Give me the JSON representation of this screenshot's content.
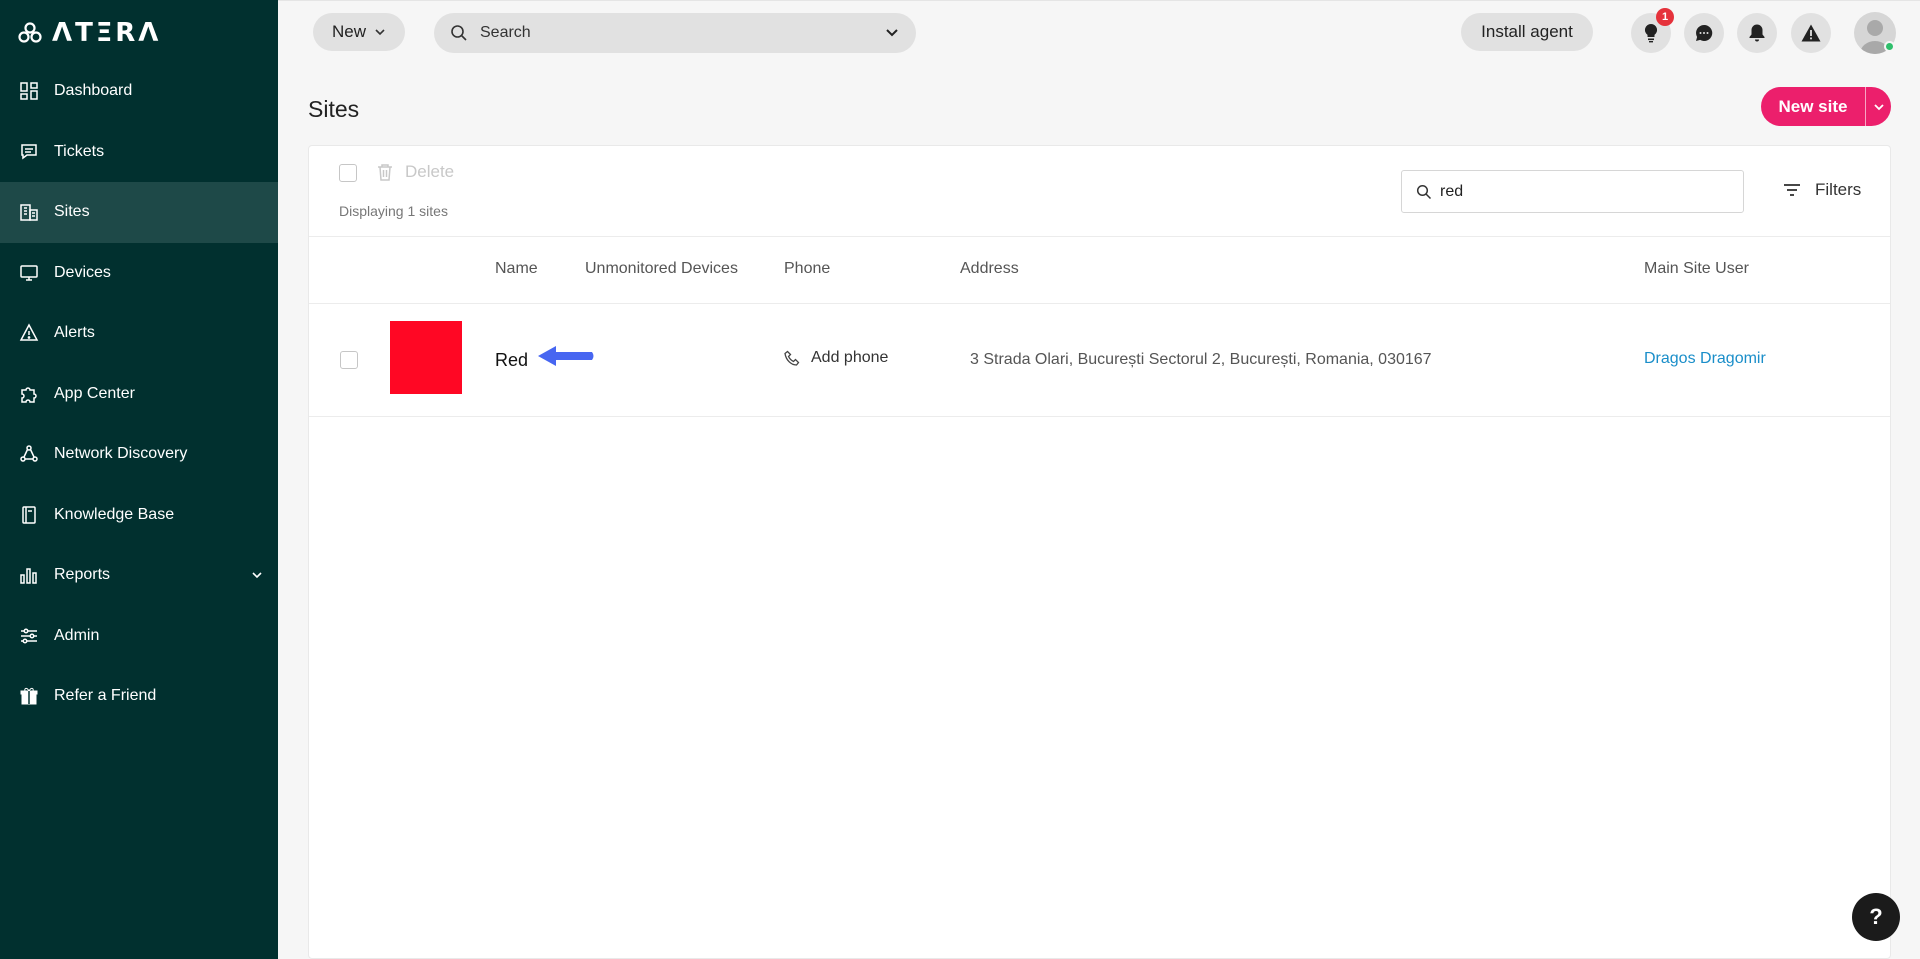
{
  "brand": {
    "name": "ΛΤΞRΛ"
  },
  "sidebar": {
    "items": [
      {
        "label": "Dashboard",
        "icon": "dashboard-icon"
      },
      {
        "label": "Tickets",
        "icon": "ticket-icon"
      },
      {
        "label": "Sites",
        "icon": "building-icon",
        "active": true
      },
      {
        "label": "Devices",
        "icon": "monitor-icon"
      },
      {
        "label": "Alerts",
        "icon": "warning-icon"
      },
      {
        "label": "App Center",
        "icon": "puzzle-icon"
      },
      {
        "label": "Network Discovery",
        "icon": "network-icon"
      },
      {
        "label": "Knowledge Base",
        "icon": "book-icon"
      },
      {
        "label": "Reports",
        "icon": "bar-chart-icon"
      },
      {
        "label": "Admin",
        "icon": "sliders-icon"
      },
      {
        "label": "Refer a Friend",
        "icon": "gift-icon"
      }
    ]
  },
  "topbar": {
    "new_label": "New",
    "search_placeholder": "Search",
    "install_label": "Install agent",
    "tips_badge": "1"
  },
  "page": {
    "title": "Sites",
    "new_site_label": "New site"
  },
  "toolbar": {
    "delete_label": "Delete",
    "display_count": "Displaying 1 sites",
    "filter_value": "red",
    "filters_label": "Filters"
  },
  "table": {
    "columns": [
      "Name",
      "Unmonitored Devices",
      "Phone",
      "Address",
      "Main Site User"
    ],
    "rows": [
      {
        "color": "#ff0724",
        "name": "Red",
        "unmonitored": "",
        "phone": "Add phone",
        "address": "3 Strada Olari, București Sectorul 2, București, Romania, 030167",
        "main_user": "Dragos Dragomir"
      }
    ]
  },
  "help_label": "?",
  "colors": {
    "sidebar": "#01302f",
    "accent": "#ec1f6c",
    "link": "#1a8ec9",
    "arrow": "#3d5ef0"
  }
}
